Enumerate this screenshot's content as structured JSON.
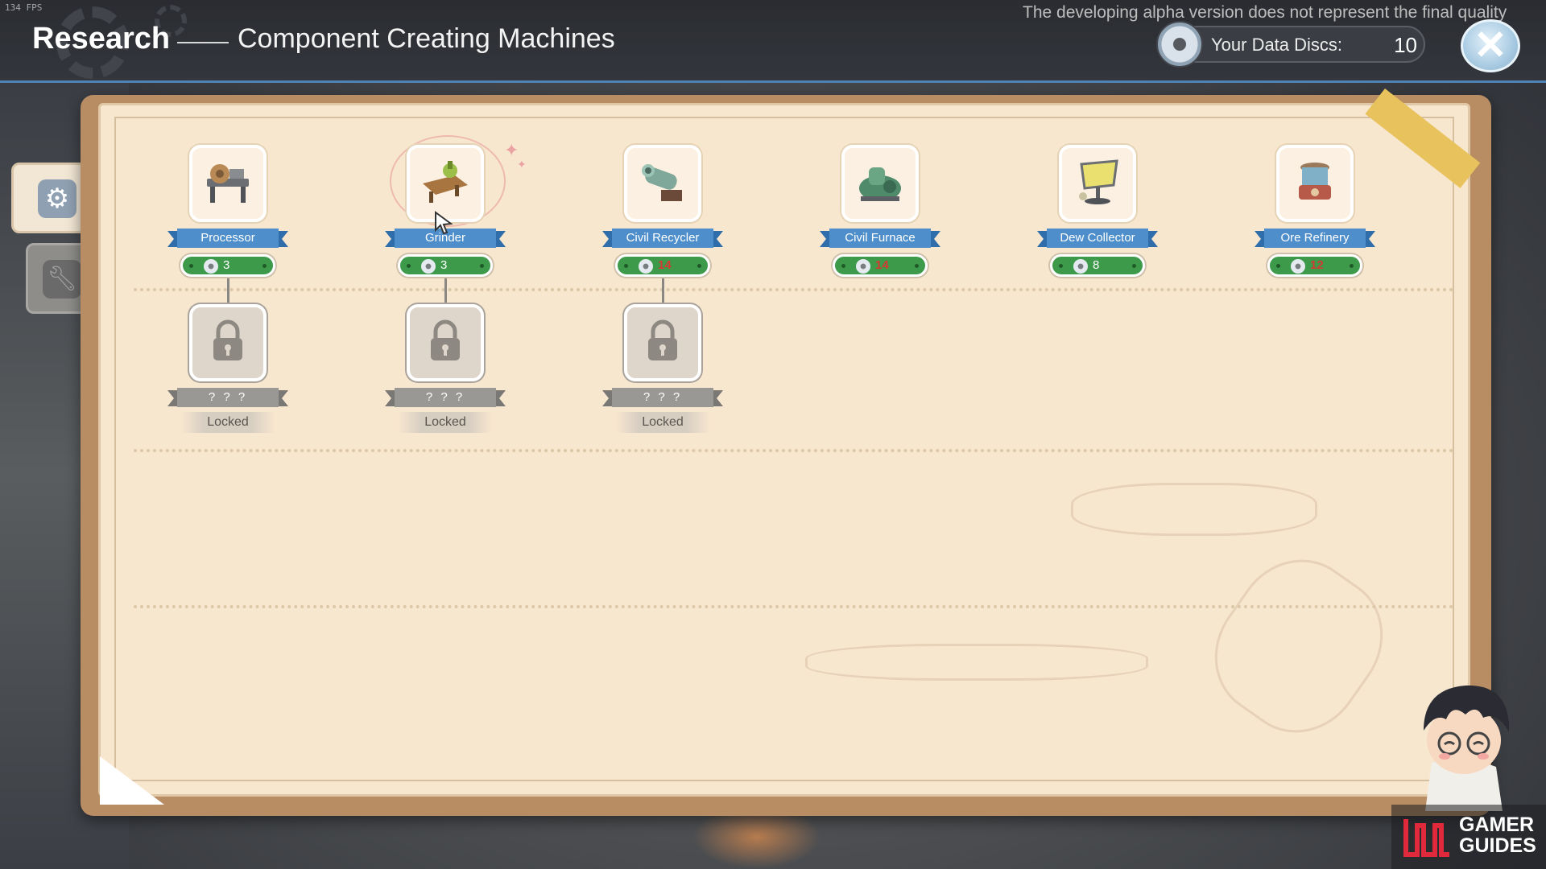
{
  "overlay": {
    "fps": "134 FPS",
    "alpha_note": "The developing alpha version does not represent the final quality"
  },
  "header": {
    "title": "Research",
    "subtitle": "Component Creating Machines",
    "data_discs_label": "Your Data Discs:",
    "data_discs_value": "10"
  },
  "sidebar": {
    "tabs": [
      {
        "icon": "gear-icon",
        "active": true
      },
      {
        "icon": "wrench-icon",
        "active": false
      }
    ]
  },
  "research_tree": {
    "unlockable": [
      {
        "name": "Processor",
        "cost": "3",
        "affordable": true
      },
      {
        "name": "Grinder",
        "cost": "3",
        "affordable": true
      },
      {
        "name": "Civil Recycler",
        "cost": "14",
        "affordable": false
      },
      {
        "name": "Civil Furnace",
        "cost": "14",
        "affordable": false
      },
      {
        "name": "Dew Collector",
        "cost": "8",
        "affordable": true
      },
      {
        "name": "Ore Refinery",
        "cost": "12",
        "affordable": false
      }
    ],
    "locked": [
      {
        "name": "? ? ?",
        "status": "Locked"
      },
      {
        "name": "? ? ?",
        "status": "Locked"
      },
      {
        "name": "? ? ?",
        "status": "Locked"
      }
    ]
  },
  "watermark": {
    "line1": "GAMER",
    "line2": "GUIDES"
  },
  "colors": {
    "accent_blue": "#4d8ecb",
    "cost_green": "#3d9a4a",
    "insufficient_red": "#d23a32",
    "paper": "#f8e7cf"
  }
}
